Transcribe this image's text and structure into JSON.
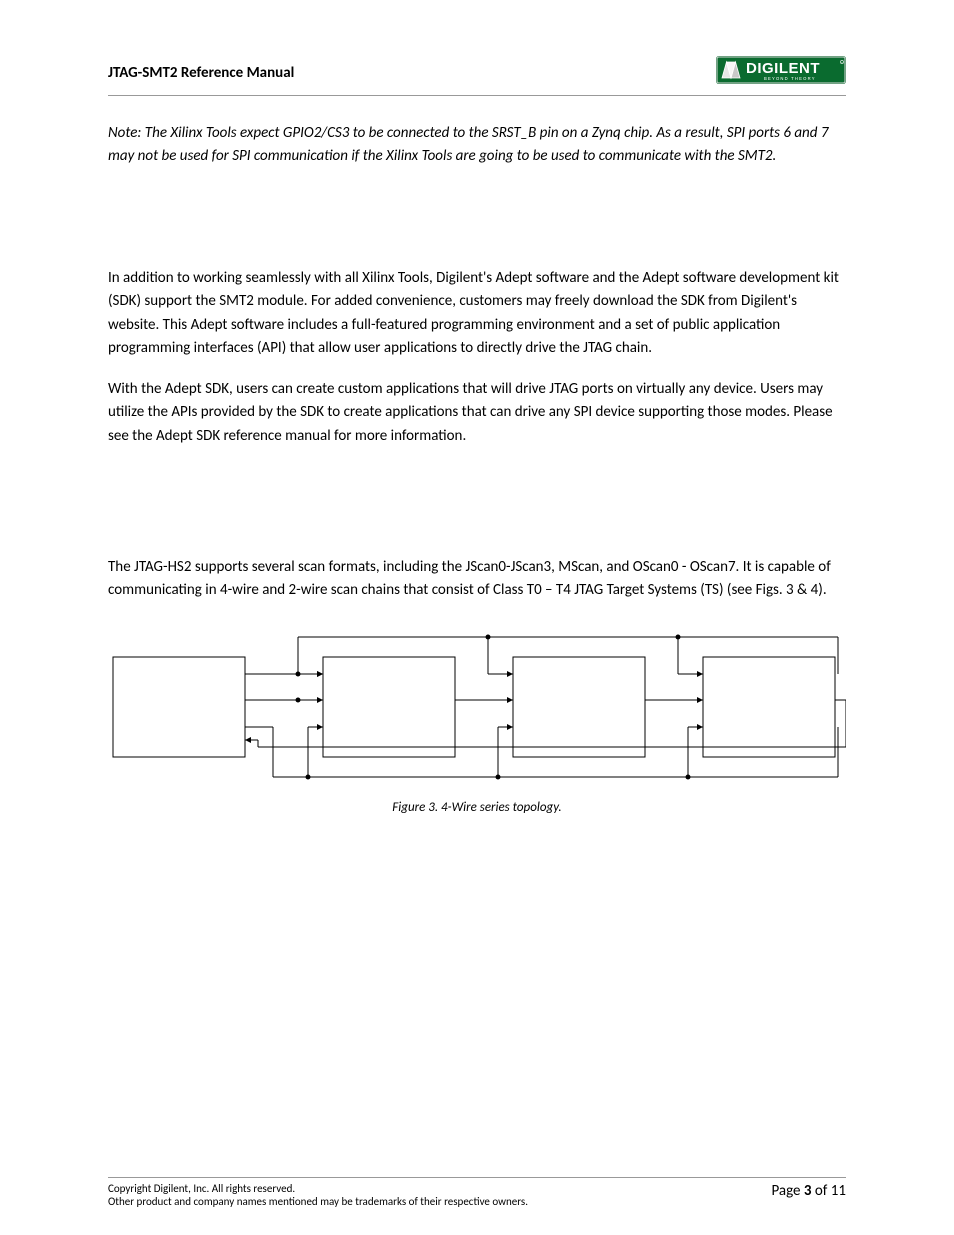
{
  "header": {
    "title": "JTAG-SMT2 Reference Manual",
    "logo_text": "DIGILENT",
    "logo_tagline": "BEYOND THEORY"
  },
  "note": "Note: The Xilinx Tools expect GPIO2/CS3 to be connected to the SRST_B pin on a Zynq chip. As a result, SPI ports 6 and 7 may not be used for SPI communication if the Xilinx Tools are going to be used to communicate with the SMT2.",
  "para1": "In addition to working seamlessly with all Xilinx Tools, Digilent's Adept software and the Adept software development kit (SDK) support the SMT2 module.  For added convenience, customers may freely download the SDK from Digilent's website. This Adept software includes a full-featured programming environment and a set of public application programming interfaces (API) that allow user applications to directly drive the JTAG chain.",
  "para2": "With the Adept SDK, users can create custom applications that will drive JTAG ports on virtually any device.  Users may utilize the APIs provided by the SDK to create applications that can drive any SPI device supporting those modes. Please see the Adept SDK reference manual for more information.",
  "para3": "The JTAG-HS2 supports several scan formats, including the JScan0-JScan3, MScan, and OScan0 - OScan7.  It is capable of communicating in 4-wire and 2-wire scan chains that consist of Class T0 – T4 JTAG Target Systems (TS) (see Figs. 3 & 4).",
  "figure_caption": "Figure 3. 4-Wire series topology.",
  "footer": {
    "line1": "Copyright Digilent, Inc. All rights reserved.",
    "line2": "Other product and company names mentioned may be trademarks of their respective owners.",
    "page_label": "Page ",
    "page_num": "3",
    "page_of": " of ",
    "page_total": "11"
  }
}
